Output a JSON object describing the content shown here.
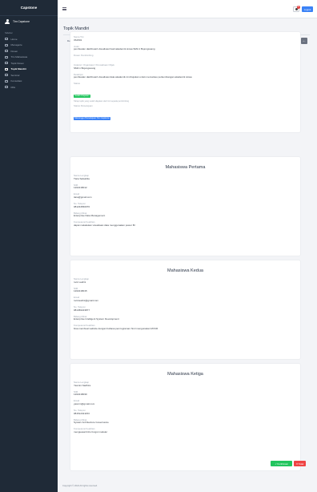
{
  "sidebar": {
    "brand": "Capstone",
    "user_name": "Tim Capstone",
    "section_label": "Sidebar",
    "items": [
      {
        "label": "Home",
        "icon": "home-icon"
      },
      {
        "label": "Menagerie",
        "icon": "folder-icon"
      },
      {
        "label": "Dosen",
        "icon": "users-icon"
      },
      {
        "label": "Tim Mahasiswa",
        "icon": "group-icon"
      },
      {
        "label": "Topik Dosen",
        "icon": "chat-icon"
      },
      {
        "label": "Topik Mandiri",
        "icon": "chat-icon",
        "active": true
      },
      {
        "label": "Seminar",
        "icon": "calendar-icon"
      },
      {
        "label": "Konsultasi",
        "icon": "comment-icon"
      },
      {
        "label": "Rilis",
        "icon": "bookmark-icon"
      }
    ]
  },
  "topbar": {
    "notification_count": "8",
    "logout_label": "Logout"
  },
  "page": {
    "title": "Topik Mandiri",
    "detail_label": "Detail"
  },
  "topic": {
    "fields": [
      {
        "label": "Nama Tim",
        "value": "IIS1501"
      },
      {
        "label": "Judul",
        "value": "pembuatan dashboard visualisasi hasil akademik siswa SMA 1 Bojongsoang"
      },
      {
        "label": "Dosen Pembimbing",
        "value": ""
      },
      {
        "label": "Instansi / Organisasi / Perusahaan Objek",
        "value": "SMA 1 Bojongsoang"
      },
      {
        "label": "Deskripsi",
        "value": "pembuatan dashboard visualisasi data akademik ini ditujukan untuk memantau perkembangan akademik siswa"
      }
    ],
    "status_label": "Status",
    "status_badge": "Sudah Diajukan",
    "status_hint": "Tahap topik yang sudah diajukan oleh tim kepada pembimbing",
    "approval_label": "Status Persetujuan",
    "approval_badge": "Menunggu Persetujuan Tim Capstone"
  },
  "members": [
    {
      "heading": "Mahasiswa Pertama",
      "fields": [
        {
          "label": "Nama Lengkap",
          "value": "Tiara Salsabila"
        },
        {
          "label": "NIM",
          "value": "1202218012"
        },
        {
          "label": "Email",
          "value": "tiara@gmail.com"
        },
        {
          "label": "No. Telepon",
          "value": "081234566076"
        },
        {
          "label": "Bidang Minat",
          "value": "Enterprise Data Management"
        },
        {
          "label": "Kompetensi Keahlian",
          "value": "dapat melakukan visualisasi data menggunakan power BI"
        }
      ]
    },
    {
      "heading": "Mahasiswa Kedua",
      "fields": [
        {
          "label": "Nama Lengkap",
          "value": "rocci audini"
        },
        {
          "label": "NIM",
          "value": "1202218015"
        },
        {
          "label": "Email",
          "value": "rocciaudini@gmail.com"
        },
        {
          "label": "No. Telepon",
          "value": "081456223877"
        },
        {
          "label": "Bidang Minat",
          "value": "Enterprise Intelligent System Development"
        },
        {
          "label": "Kompetensi Keahlian",
          "value": "bisa membuat website dengan bahasa pemrograman html mengunakan MVCR"
        }
      ]
    },
    {
      "heading": "Mahasiswa Ketiga",
      "fields": [
        {
          "label": "Nama Lengkap",
          "value": "Yasmin Nadhira"
        },
        {
          "label": "NIM",
          "value": "1202218030"
        },
        {
          "label": "Email",
          "value": "yasmin@gmail.com"
        },
        {
          "label": "No. Telepon",
          "value": "081512321153"
        },
        {
          "label": "Bidang Minat",
          "value": "System Architecture Governance"
        },
        {
          "label": "Kompetensi Keahlian",
          "value": "menguasai bizio fungsi modeler"
        }
      ]
    }
  ],
  "actions": {
    "approve_label": "✓ Konfirmasi",
    "reject_label": "✕ Tolak"
  },
  "footer": {
    "text": "Copyright © 2024 All rights reserved."
  }
}
